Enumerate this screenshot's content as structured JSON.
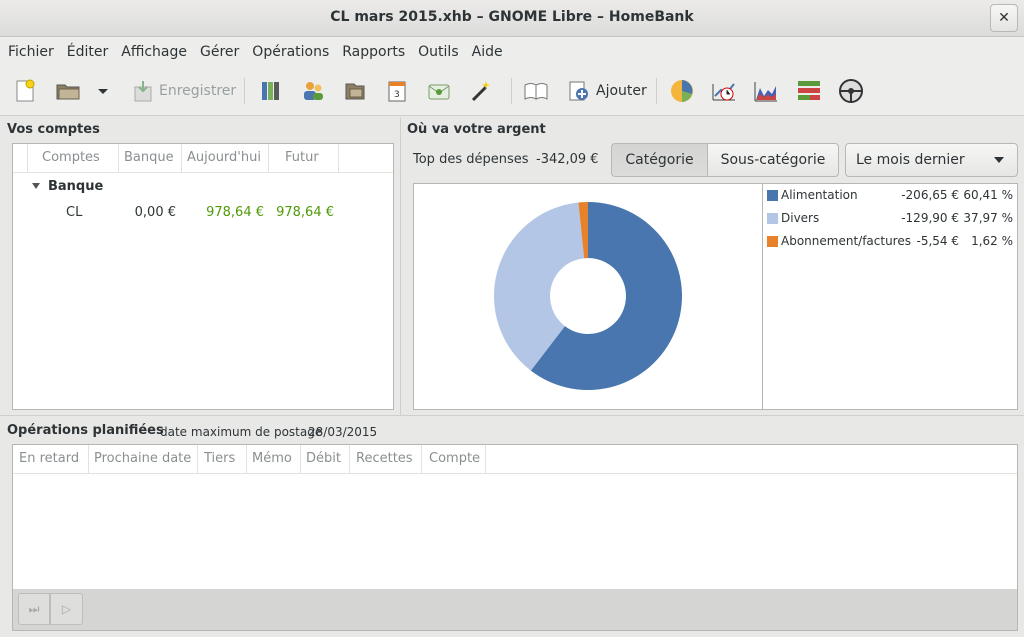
{
  "window": {
    "title": "CL mars 2015.xhb – GNOME Libre – HomeBank",
    "close_symbol": "✕"
  },
  "menu": [
    "Fichier",
    "Éditer",
    "Affichage",
    "Gérer",
    "Opérations",
    "Rapports",
    "Outils",
    "Aide"
  ],
  "toolbar": {
    "save_label": "Enregistrer",
    "add_label": "Ajouter",
    "icons": [
      "new-file-icon",
      "open-file-icon",
      "dropdown-arrow-icon",
      "save-icon",
      "accounts-icon",
      "payees-icon",
      "categories-icon",
      "scheduled-icon",
      "budget-icon",
      "assistant-icon",
      "show-operations-icon",
      "add-operation-icon",
      "statistics-icon",
      "trend-time-icon",
      "balance-report-icon",
      "budget-report-icon",
      "car-cost-icon"
    ]
  },
  "accounts": {
    "title": "Vos comptes",
    "columns": [
      "Comptes",
      "Banque",
      "Aujourd'hui",
      "Futur"
    ],
    "groups": [
      {
        "name": "Banque",
        "expanded": true,
        "rows": [
          {
            "name": "CL",
            "bank": "0,00 €",
            "today": "978,64 €",
            "future": "978,64 €"
          }
        ]
      }
    ]
  },
  "spending": {
    "title": "Où va votre argent",
    "top_label": "Top des dépenses",
    "top_value": "-342,09 €",
    "tab_category": "Catégorie",
    "tab_subcategory": "Sous-catégorie",
    "period": "Le mois dernier",
    "active_tab": "category"
  },
  "chart_data": {
    "type": "pie",
    "donut": true,
    "series": [
      {
        "name": "Alimentation",
        "amount": -206.65,
        "amount_text": "-206,65 €",
        "percent": 60.41,
        "percent_text": "60,41 %",
        "color": "#4a76b0"
      },
      {
        "name": "Divers",
        "amount": -129.9,
        "amount_text": "-129,90 €",
        "percent": 37.97,
        "percent_text": "37,97 %",
        "color": "#b3c6e6"
      },
      {
        "name": "Abonnement/factures",
        "amount": -5.54,
        "amount_text": "-5,54 €",
        "percent": 1.62,
        "percent_text": "1,62 %",
        "color": "#e8822a"
      }
    ],
    "legend_position": "right"
  },
  "scheduled": {
    "title": "Opérations planifiées",
    "max_date_label": "date maximum de postage",
    "max_date": "28/03/2015",
    "columns": [
      "En retard",
      "Prochaine date",
      "Tiers",
      "Mémo",
      "Débit",
      "Recettes",
      "Compte"
    ],
    "rows": [],
    "skip_symbol": "⏭",
    "post_symbol": "▷"
  }
}
